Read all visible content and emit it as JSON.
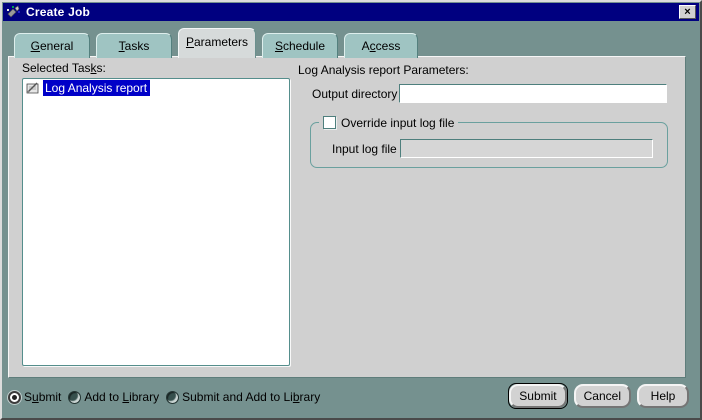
{
  "window": {
    "title": "Create Job"
  },
  "icons": {
    "close": "×",
    "app_icon": "job-sparkle-icon",
    "task_icon": "report-note-icon"
  },
  "tabs": [
    {
      "pre": "",
      "key": "G",
      "post": "eneral",
      "active": false
    },
    {
      "pre": "",
      "key": "T",
      "post": "asks",
      "active": false
    },
    {
      "pre": "",
      "key": "P",
      "post": "arameters",
      "active": true
    },
    {
      "pre": "",
      "key": "S",
      "post": "chedule",
      "active": false
    },
    {
      "pre": "A",
      "key": "c",
      "post": "cess",
      "active": false
    }
  ],
  "selected_tasks": {
    "label": {
      "pre": "Selected Tas",
      "key": "k",
      "post": "s:"
    },
    "items": [
      {
        "label": "Log Analysis report",
        "selected": true
      }
    ]
  },
  "parameters": {
    "heading": "Log Analysis report Parameters:",
    "output_directory": {
      "label": "Output directory",
      "value": ""
    },
    "override_group": {
      "checkbox_label": "Override input log file",
      "checked": false,
      "input_label": "Input log file",
      "input_value": "",
      "input_disabled": true
    }
  },
  "footer": {
    "radios": [
      {
        "pre": "S",
        "key": "u",
        "post": "bmit",
        "selected": true
      },
      {
        "pre": "Add to ",
        "key": "L",
        "post": "ibrary",
        "selected": false
      },
      {
        "pre": "Submit and Add to Li",
        "key": "b",
        "post": "rary",
        "selected": false
      }
    ],
    "buttons": [
      {
        "label": "Submit",
        "default": true
      },
      {
        "label": "Cancel",
        "default": false
      },
      {
        "label": "Help",
        "default": false
      }
    ]
  },
  "colors": {
    "titlebar": "#000080",
    "window_bg": "#75918f",
    "panel_bg": "#d0d0d0",
    "tab_inactive": "#9fc4c2",
    "tab_active": "#d6dada",
    "selection": "#0000c8",
    "field_border": "#4e7f7d"
  }
}
